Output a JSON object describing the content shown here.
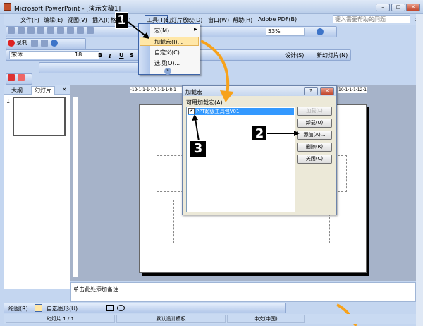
{
  "window": {
    "title": "Microsoft PowerPoint - [演示文稿1]",
    "min": "–",
    "max": "□",
    "close": "✕"
  },
  "menubar": {
    "items": [
      "文件(F)",
      "编辑(E)",
      "视图(V)",
      "插入(I)",
      "格式(O)",
      "工具(T)",
      "幻灯片放映(D)",
      "窗口(W)",
      "帮助(H)",
      "Adobe PDF(B)"
    ],
    "help_placeholder": "键入需要帮助的问题",
    "close": "×"
  },
  "toolbar": {
    "zoom": "53%",
    "record": "录制",
    "font": "宋体",
    "size": "18",
    "bold": "B",
    "italic": "I",
    "underline": "U",
    "shadow": "S",
    "design": "设计(S)",
    "new_slide": "新幻灯片(N)"
  },
  "tools_menu": {
    "items": [
      "宏(M)",
      "加载宏(I)...",
      "自定义(C)...",
      "选项(O)..."
    ],
    "more": "»"
  },
  "left_pane": {
    "tabs": [
      "大纲",
      "幻灯片"
    ],
    "close": "×",
    "slide_number": "1"
  },
  "ruler": {
    "top_marks": "·12·1·1·1·10·1·1·1·8·1",
    "right_marks": "10·1·1·1·12·1"
  },
  "dialog": {
    "title": "加载宏",
    "help": "?",
    "close": "✕",
    "list_label": "可用加载宏(A):",
    "items": [
      {
        "name": "PPT超级工具包V01",
        "checked": true
      }
    ],
    "buttons": [
      "加载(L)",
      "卸载(U)",
      "添加(A)...",
      "删除(R)",
      "关闭(C)"
    ]
  },
  "annotations": [
    "1",
    "2",
    "3"
  ],
  "notes": {
    "placeholder": "单击此处添加备注"
  },
  "draw_toolbar": {
    "draw": "绘图(R)",
    "autoshapes": "自选图形(U)"
  },
  "status": {
    "slide": "幻灯片 1 / 1",
    "template": "默认设计模板",
    "language": "中文(中国)"
  },
  "colors": {
    "accent_orange": "#f7a21b",
    "selection": "#3399ff",
    "menu_highlight": "#ffe7a8"
  }
}
